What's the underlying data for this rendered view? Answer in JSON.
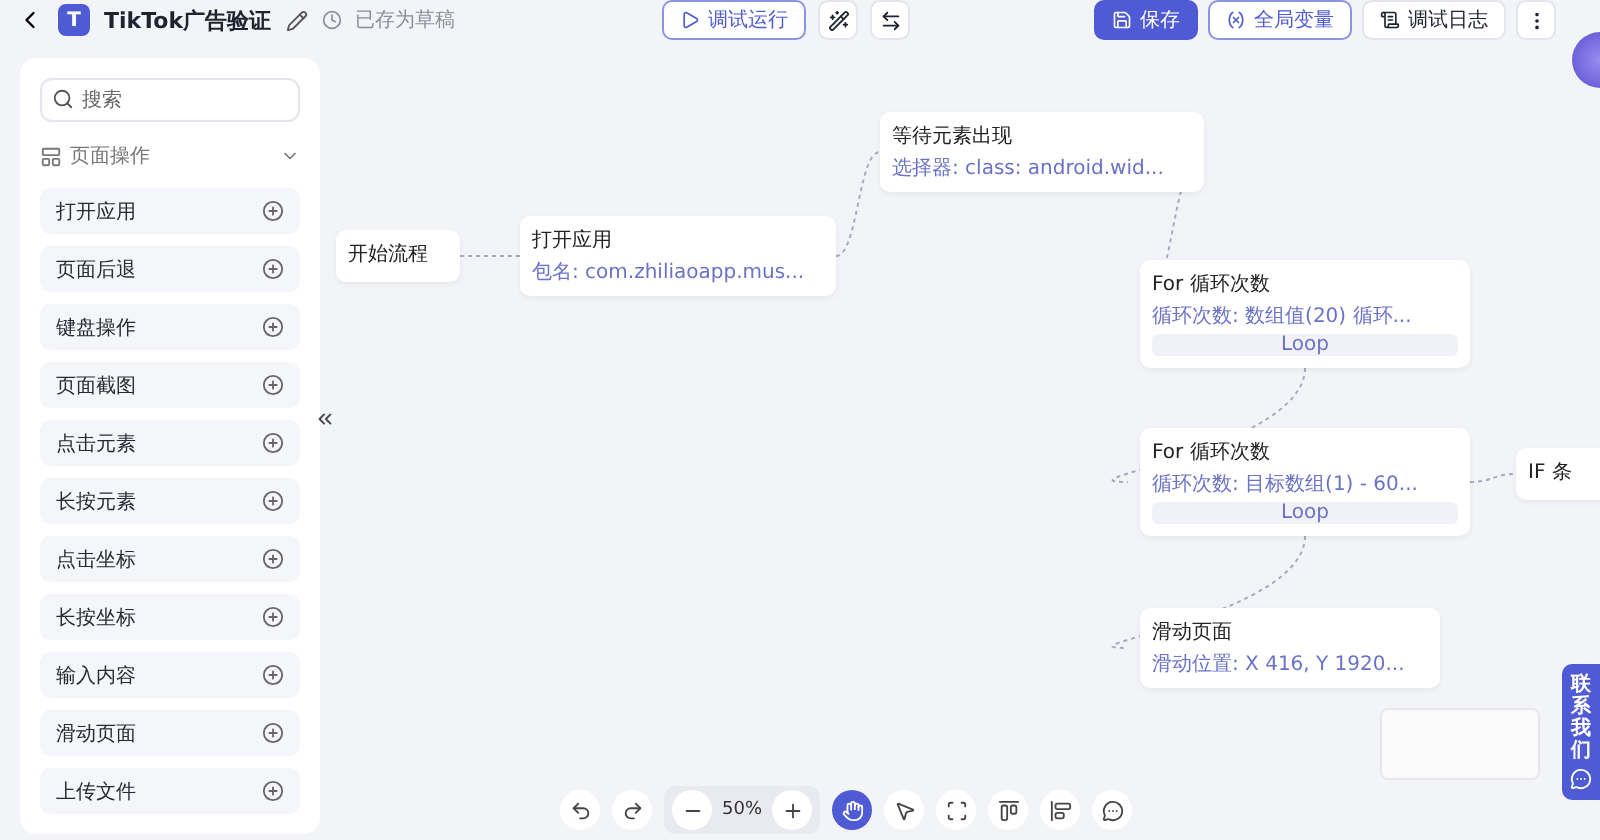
{
  "header": {
    "logo": "T",
    "title": "TikTok广告验证",
    "status": "已存为草稿",
    "run_button": "调试运行",
    "save_button": "保存",
    "variables_button": "全局变量",
    "log_button": "调试日志"
  },
  "sidebar": {
    "search": {
      "placeholder": "搜索"
    },
    "section": {
      "title": "页面操作",
      "expanded": true
    },
    "items": [
      "打开应用",
      "页面后退",
      "键盘操作",
      "页面截图",
      "点击元素",
      "长按元素",
      "点击坐标",
      "长按坐标",
      "输入内容",
      "滑动页面",
      "上传文件"
    ]
  },
  "canvas": {
    "nodes": [
      {
        "kind": "plain",
        "title": "开始流程"
      },
      {
        "kind": "detail",
        "title": "打开应用",
        "detail": "包名: com.zhiliaoapp.mus..."
      },
      {
        "kind": "detail",
        "title": "等待元素出现",
        "detail": "选择器: class: android.wid..."
      },
      {
        "kind": "loop",
        "title": "For 循环次数",
        "detail": "循环次数: 数组值(20) 循环...",
        "tag": "Loop"
      },
      {
        "kind": "loop",
        "title": "For 循环次数",
        "detail": "循环次数: 目标数组(1) - 60...",
        "tag": "Loop"
      },
      {
        "kind": "detail",
        "title": "滑动页面",
        "detail": "滑动位置: X 416, Y 1920..."
      },
      {
        "kind": "plain",
        "title": "IF 条"
      }
    ]
  },
  "toolbar": {
    "zoom": "50%",
    "tools": [
      {
        "kind": "hand",
        "selected": true
      },
      {
        "kind": "pointer",
        "selected": false
      }
    ]
  },
  "contact": {
    "label": "联系我们"
  }
}
